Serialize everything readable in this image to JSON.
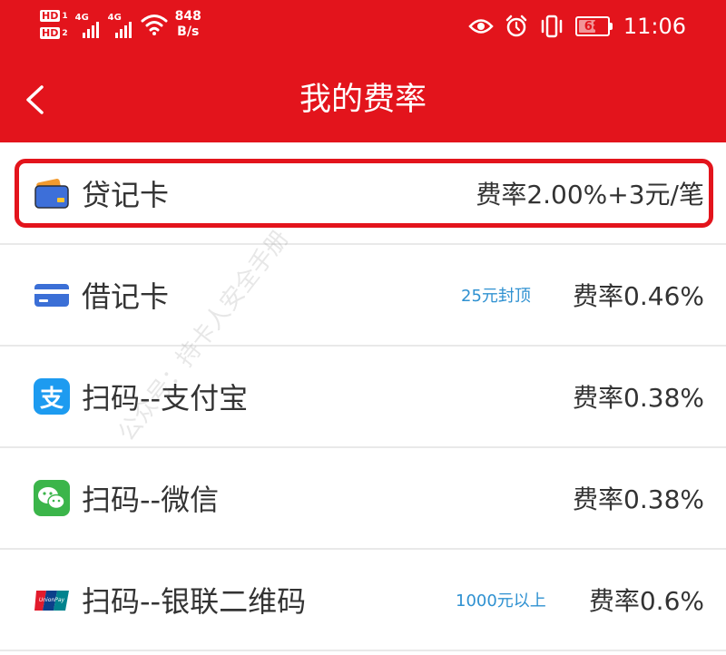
{
  "status_bar": {
    "hd1": "HD",
    "hd1_num": "1",
    "hd2": "HD",
    "hd2_num": "2",
    "net1": "4G",
    "net2": "4G",
    "speed_value": "848",
    "speed_unit": "B/s",
    "battery_level": "68",
    "battery_fraction": 0.68,
    "time": "11:06",
    "icons": [
      "hd-icon",
      "signal-icon",
      "wifi-icon",
      "eye-icon",
      "alarm-icon",
      "vibrate-icon",
      "battery-icon"
    ]
  },
  "header": {
    "title": "我的费率",
    "back_icon": "chevron-left-icon",
    "background": "#e3141c"
  },
  "rates": [
    {
      "label": "贷记卡",
      "note": "",
      "rate": "费率2.00%+3元/笔",
      "icon": "credit-card-icon",
      "highlighted": true
    },
    {
      "label": "借记卡",
      "note": "25元封顶",
      "rate": "费率0.46%",
      "icon": "debit-card-icon",
      "highlighted": false
    },
    {
      "label": "扫码--支付宝",
      "note": "",
      "rate": "费率0.38%",
      "icon": "alipay-icon",
      "highlighted": false
    },
    {
      "label": "扫码--微信",
      "note": "",
      "rate": "费率0.38%",
      "icon": "wechat-icon",
      "highlighted": false
    },
    {
      "label": "扫码--银联二维码",
      "note": "1000元以上",
      "rate": "费率0.6%",
      "icon": "unionpay-icon",
      "highlighted": false
    }
  ],
  "unionpay_logo_text": "UnionPay 银联",
  "watermark": "公众号：持卡人安全手册",
  "colors": {
    "accent": "#e3141c",
    "note_blue": "#2f91d1",
    "text": "#333333",
    "divider": "#e9e9e9"
  }
}
